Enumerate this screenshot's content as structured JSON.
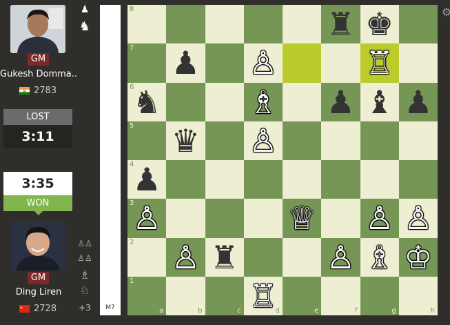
{
  "top_player": {
    "name": "Gukesh Domma...",
    "title": "GM",
    "rating": "2783",
    "flag": "India",
    "result": "LOST",
    "clock": "3:11",
    "captured": [
      "♟",
      "♞"
    ]
  },
  "bottom_player": {
    "name": "Ding Liren",
    "title": "GM",
    "rating": "2728",
    "flag": "China",
    "result": "WON",
    "clock": "3:35",
    "captured": [
      "♙♙",
      "♙♙",
      "♗",
      "♘"
    ],
    "material_advantage": "+3"
  },
  "eval_bar": {
    "label": "M7"
  },
  "board": {
    "ranks": [
      "8",
      "7",
      "6",
      "5",
      "4",
      "3",
      "2",
      "1"
    ],
    "files": [
      "a",
      "b",
      "c",
      "d",
      "e",
      "f",
      "g",
      "h"
    ],
    "highlighted": [
      "e7",
      "g7"
    ],
    "pieces": {
      "f8": "♜",
      "g8": "♚",
      "b7": "♟",
      "d7": "♙",
      "g7": "♖",
      "a6": "♞",
      "d6": "♗",
      "f6": "♟",
      "g6": "♝",
      "h6": "♟",
      "b5": "♛",
      "d5": "♙",
      "a4": "♟",
      "a3": "♙",
      "e3": "♕",
      "g3": "♙",
      "h3": "♙",
      "b2": "♙",
      "c2": "♜",
      "f2": "♙",
      "g2": "♗",
      "h2": "♔",
      "d1": "♖"
    }
  },
  "colors": {
    "light": "#eeeed2",
    "dark": "#769656",
    "highlight": "#bbcb2b",
    "won": "#81b64c",
    "lost": "#6b6b6b"
  },
  "icons": {
    "settings": "gear-icon"
  }
}
